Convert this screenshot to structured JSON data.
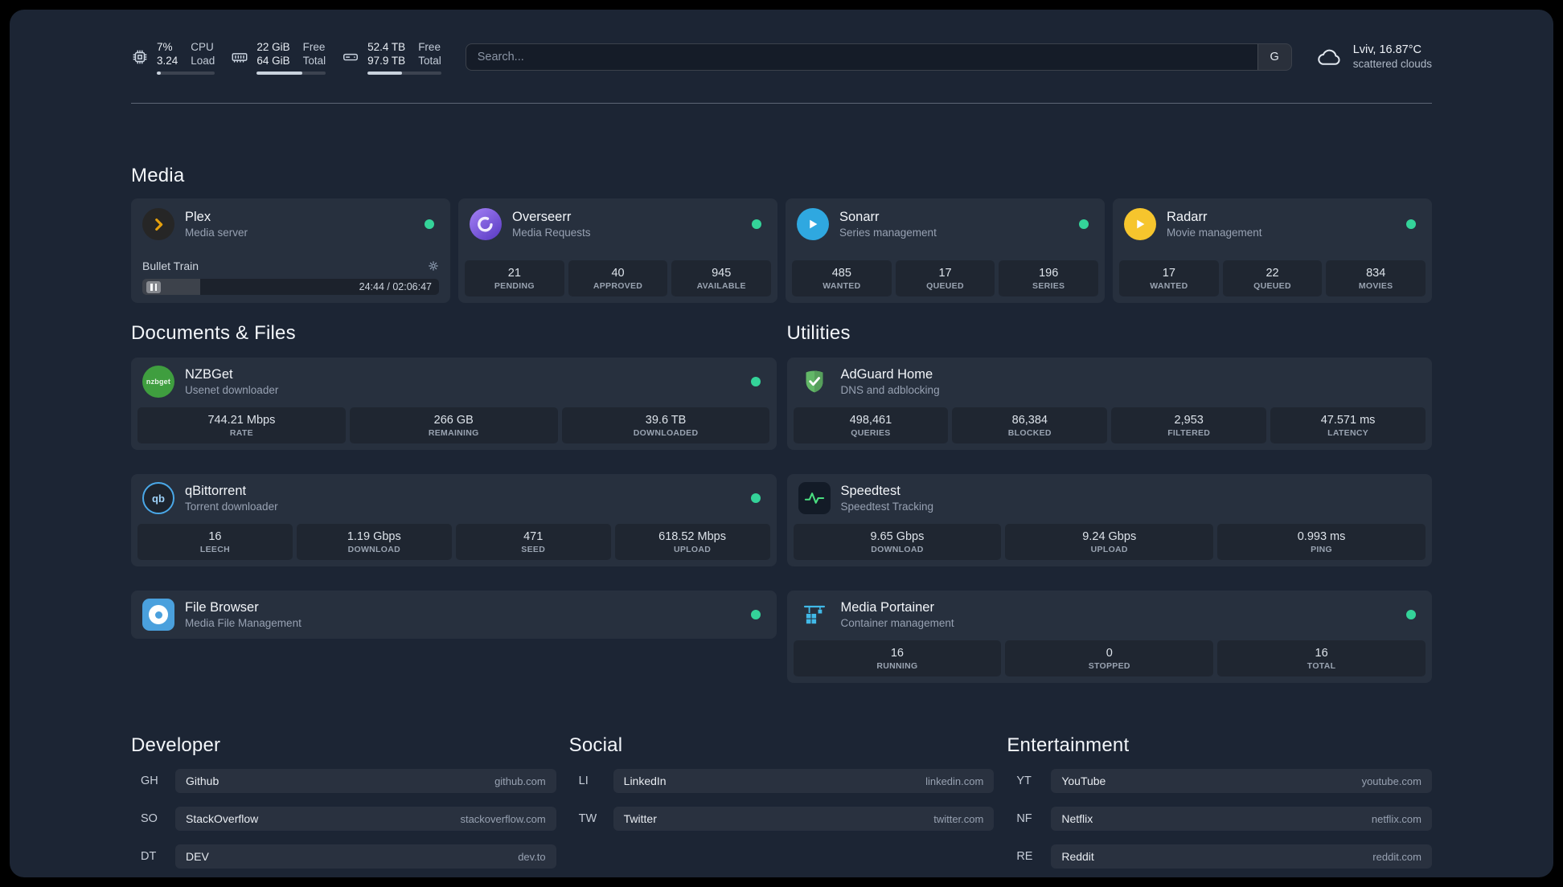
{
  "colors": {
    "background": "#1c2534",
    "status_online": "#34d399",
    "plex_accent": "#e5a00d",
    "speedtest_line": "#4ade80"
  },
  "topbar": {
    "cpu": {
      "icon": "cpu-chip-icon",
      "value_top": "7%",
      "value_bottom": "3.24",
      "label_top": "CPU",
      "label_bottom": "Load",
      "bar_percent": 7
    },
    "memory": {
      "icon": "memory-icon",
      "value_top": "22 GiB",
      "value_bottom": "64 GiB",
      "label_top": "Free",
      "label_bottom": "Total",
      "bar_percent": 66
    },
    "disk": {
      "icon": "hard-disk-icon",
      "value_top": "52.4 TB",
      "value_bottom": "97.9 TB",
      "label_top": "Free",
      "label_bottom": "Total",
      "bar_percent": 47
    },
    "search": {
      "placeholder": "Search...",
      "provider_label": "G"
    },
    "weather": {
      "icon": "cloud-icon",
      "location": "Lviv, 16.87°C",
      "condition": "scattered clouds"
    }
  },
  "sections": {
    "media": {
      "title": "Media",
      "cards": {
        "plex": {
          "icon": "plex-logo",
          "title": "Plex",
          "subtitle": "Media server",
          "status": "online",
          "player": {
            "track_title": "Bullet Train",
            "state": "paused",
            "time": "24:44 / 02:06:47",
            "progress_percent": 19.5
          }
        },
        "overseerr": {
          "icon": "overseerr-logo",
          "title": "Overseerr",
          "subtitle": "Media Requests",
          "status": "online",
          "stats": [
            {
              "value": "21",
              "label": "PENDING"
            },
            {
              "value": "40",
              "label": "APPROVED"
            },
            {
              "value": "945",
              "label": "AVAILABLE"
            }
          ]
        },
        "sonarr": {
          "icon": "sonarr-logo",
          "title": "Sonarr",
          "subtitle": "Series management",
          "status": "online",
          "stats": [
            {
              "value": "485",
              "label": "WANTED"
            },
            {
              "value": "17",
              "label": "QUEUED"
            },
            {
              "value": "196",
              "label": "SERIES"
            }
          ]
        },
        "radarr": {
          "icon": "radarr-logo",
          "title": "Radarr",
          "subtitle": "Movie management",
          "status": "online",
          "stats": [
            {
              "value": "17",
              "label": "WANTED"
            },
            {
              "value": "22",
              "label": "QUEUED"
            },
            {
              "value": "834",
              "label": "MOVIES"
            }
          ]
        }
      }
    },
    "documents": {
      "title": "Documents & Files",
      "cards": {
        "nzbget": {
          "icon": "nzbget-logo",
          "icon_text": "nzbget",
          "title": "NZBGet",
          "subtitle": "Usenet downloader",
          "status": "online",
          "stats": [
            {
              "value": "744.21 Mbps",
              "label": "RATE"
            },
            {
              "value": "266 GB",
              "label": "REMAINING"
            },
            {
              "value": "39.6 TB",
              "label": "DOWNLOADED"
            }
          ]
        },
        "qbittorrent": {
          "icon": "qbittorrent-logo",
          "icon_text": "qb",
          "title": "qBittorrent",
          "subtitle": "Torrent downloader",
          "status": "online",
          "stats": [
            {
              "value": "16",
              "label": "LEECH"
            },
            {
              "value": "1.19 Gbps",
              "label": "DOWNLOAD"
            },
            {
              "value": "471",
              "label": "SEED"
            },
            {
              "value": "618.52 Mbps",
              "label": "UPLOAD"
            }
          ]
        },
        "filebrowser": {
          "icon": "filebrowser-logo",
          "title": "File Browser",
          "subtitle": "Media File Management",
          "status": "online"
        }
      }
    },
    "utilities": {
      "title": "Utilities",
      "cards": {
        "adguard": {
          "icon": "adguard-shield-logo",
          "title": "AdGuard Home",
          "subtitle": "DNS and adblocking",
          "stats": [
            {
              "value": "498,461",
              "label": "QUERIES"
            },
            {
              "value": "86,384",
              "label": "BLOCKED"
            },
            {
              "value": "2,953",
              "label": "FILTERED"
            },
            {
              "value": "47.571 ms",
              "label": "LATENCY"
            }
          ]
        },
        "speedtest": {
          "icon": "speedtest-pulse-logo",
          "title": "Speedtest",
          "subtitle": "Speedtest Tracking",
          "stats": [
            {
              "value": "9.65 Gbps",
              "label": "DOWNLOAD"
            },
            {
              "value": "9.24 Gbps",
              "label": "UPLOAD"
            },
            {
              "value": "0.993 ms",
              "label": "PING"
            }
          ]
        },
        "portainer": {
          "icon": "portainer-crane-logo",
          "title": "Media Portainer",
          "subtitle": "Container management",
          "status": "online",
          "stats": [
            {
              "value": "16",
              "label": "RUNNING"
            },
            {
              "value": "0",
              "label": "STOPPED"
            },
            {
              "value": "16",
              "label": "TOTAL"
            }
          ]
        }
      }
    }
  },
  "bookmarks": {
    "developer": {
      "title": "Developer",
      "items": [
        {
          "abbr": "GH",
          "name": "Github",
          "url": "github.com"
        },
        {
          "abbr": "SO",
          "name": "StackOverflow",
          "url": "stackoverflow.com"
        },
        {
          "abbr": "DT",
          "name": "DEV",
          "url": "dev.to"
        }
      ]
    },
    "social": {
      "title": "Social",
      "items": [
        {
          "abbr": "LI",
          "name": "LinkedIn",
          "url": "linkedin.com"
        },
        {
          "abbr": "TW",
          "name": "Twitter",
          "url": "twitter.com"
        }
      ]
    },
    "entertainment": {
      "title": "Entertainment",
      "items": [
        {
          "abbr": "YT",
          "name": "YouTube",
          "url": "youtube.com"
        },
        {
          "abbr": "NF",
          "name": "Netflix",
          "url": "netflix.com"
        },
        {
          "abbr": "RE",
          "name": "Reddit",
          "url": "reddit.com"
        }
      ]
    }
  }
}
